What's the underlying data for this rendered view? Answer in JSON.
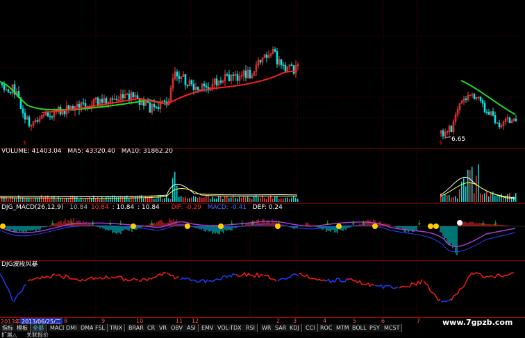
{
  "main": {
    "low_label": "6.65",
    "marker": "$"
  },
  "volume": {
    "label": "VOLUME: 41403.04",
    "ma5": "MA5: 43320.40",
    "ma10": "MA10: 31862.20"
  },
  "macd": {
    "name": "DJG_MACD(26,12,9)",
    "v1": "10.84",
    "v2": "10.84",
    "v3": ": 10.84",
    "v4": ": 10.84",
    "dif": "DIF: -0.29",
    "macd": "MACD: -0.41",
    "def": "DEF: 0.24"
  },
  "wind": {
    "name": "DJG波段风暴"
  },
  "axis": {
    "year": "2013年",
    "current_date": "2013/06/25/二",
    "months": [
      "8",
      "9",
      "10",
      "11",
      "12",
      "2",
      "3",
      "4",
      "5",
      "6",
      "7"
    ]
  },
  "tabs": [
    "指标",
    "模板",
    "全部",
    "MACD",
    "DMI",
    "DMA",
    "FSL",
    "TRIX",
    "BRAR",
    "CR",
    "VR",
    "OBV",
    "ASI",
    "EMV",
    "VOL-TDX",
    "RSI",
    "WR",
    "SAR",
    "KDJ",
    "CCI",
    "ROC",
    "MTM",
    "BOLL",
    "PSY",
    "MCST"
  ],
  "bottom_tabs": [
    "扩展△",
    "关联报价"
  ],
  "watermark": "www.7gpzb.com",
  "colors": {
    "up": "#ff3b3b",
    "down": "#00ffff",
    "ma_red": "#ff2020",
    "ma_green": "#22dd22",
    "macd_purple": "#a43bd6",
    "wind_blue": "#1f3cff",
    "wind_red": "#ff1a1a"
  }
}
